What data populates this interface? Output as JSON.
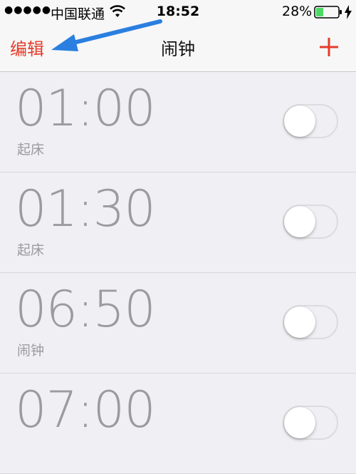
{
  "status_bar": {
    "signal": "●●●●●",
    "carrier": "中国联通",
    "time": "18:52",
    "battery_percent": "28%",
    "icons": [
      "wifi-icon",
      "battery-icon",
      "charging-bolt-icon"
    ]
  },
  "nav": {
    "edit_label": "编辑",
    "title": "闹钟",
    "add_icon": "plus-icon",
    "accent_color": "#e53c2b"
  },
  "annotation": {
    "icon": "blue-arrow-pointing-to-edit",
    "color": "#2a7fe0"
  },
  "alarms": [
    {
      "time": "01:00",
      "label": "起床",
      "enabled": false
    },
    {
      "time": "01:30",
      "label": "起床",
      "enabled": false
    },
    {
      "time": "06:50",
      "label": "闹钟",
      "enabled": false
    },
    {
      "time": "07:00",
      "label": "",
      "enabled": false
    }
  ]
}
